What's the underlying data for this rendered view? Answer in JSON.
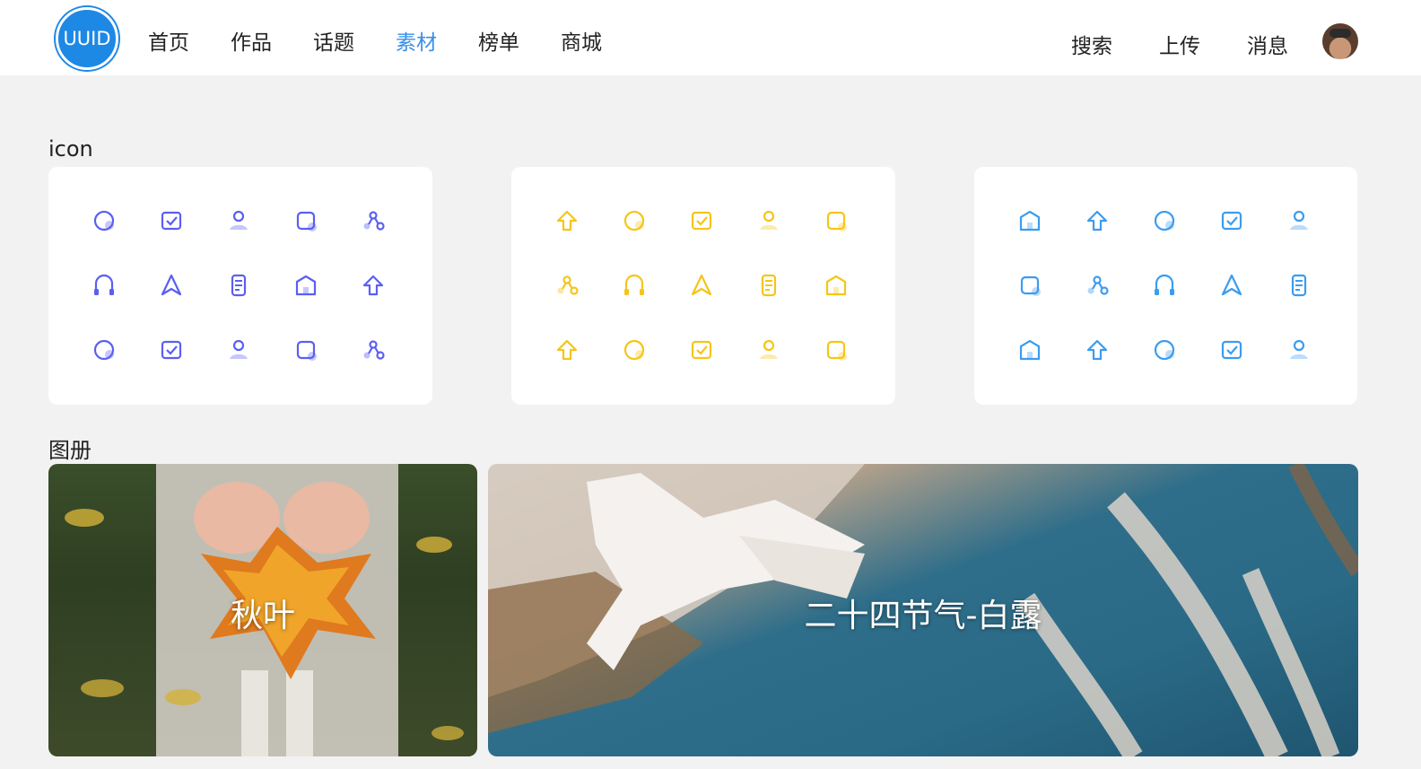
{
  "brand": {
    "logo_text": "UUID",
    "accent": "#1e88e5"
  },
  "nav": {
    "left": [
      "首页",
      "作品",
      "话题",
      "素材",
      "榜单",
      "商城"
    ],
    "active_index": 3,
    "right": [
      "搜索",
      "上传",
      "消息"
    ]
  },
  "sections": {
    "icon_title": "icon",
    "album_title": "图册"
  },
  "icon_cards": [
    {
      "color": "#5b5ff0",
      "icons": [
        "heart-icon",
        "crown-icon",
        "navigation-icon",
        "upload-arrow-icon",
        "user-icon",
        "watch-icon",
        "headphones-icon",
        "dome-icon",
        "bookmark-icon",
        "location-user-icon",
        "cup-icon",
        "search-bubble-icon",
        "edit-icon",
        "bluetooth-icon",
        "clock-icon"
      ]
    },
    {
      "color": "#f5c518",
      "icons": [
        "note-icon",
        "chat-icon",
        "search-icon",
        "compass-icon",
        "user-circle-icon",
        "home-icon",
        "diamond-icon",
        "play-icon",
        "bowtie-icon",
        "sort-icon",
        "cloche-icon",
        "shop-icon",
        "film-reel-icon",
        "gamepad-icon",
        "person-icon"
      ]
    },
    {
      "color": "#3b9cf0",
      "icons": [
        "settings-icon",
        "apps-icon",
        "bell-icon",
        "documents-icon",
        "user-card-icon",
        "lock-icon",
        "org-chart-icon",
        "hand-pointer-icon",
        "presentation-icon",
        "user-transfer-icon",
        "layout-icon",
        "id-card-icon",
        "checklist-icon",
        "file-icon",
        "share-nodes-icon"
      ]
    }
  ],
  "albums": [
    {
      "title": "秋叶"
    },
    {
      "title": "二十四节气-白露"
    }
  ]
}
